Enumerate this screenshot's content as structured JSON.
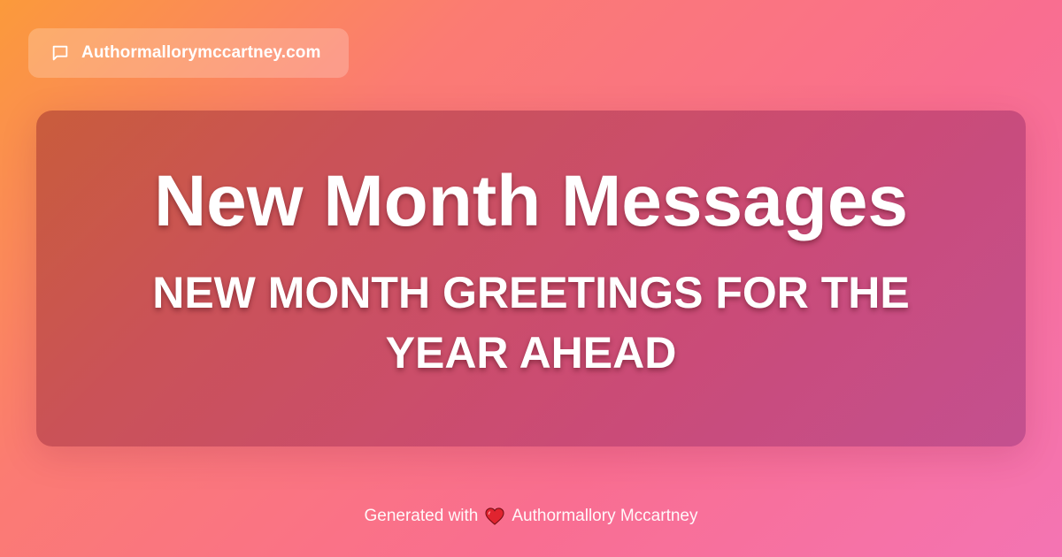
{
  "site": {
    "name": "Authormallorymccartney.com",
    "icon": "chat-bubble-icon"
  },
  "hero": {
    "title": "New Month Messages",
    "subtitle": "NEW MONTH GREETINGS FOR THE YEAR AHEAD"
  },
  "footer": {
    "prefix": "Generated with",
    "icon": "heart-icon",
    "author": "Authormallory Mccartney"
  },
  "colors": {
    "gradient_start": "#fb9a3b",
    "gradient_mid": "#fb7b73",
    "gradient_end": "#f474b3",
    "heart": "#e0242f"
  }
}
